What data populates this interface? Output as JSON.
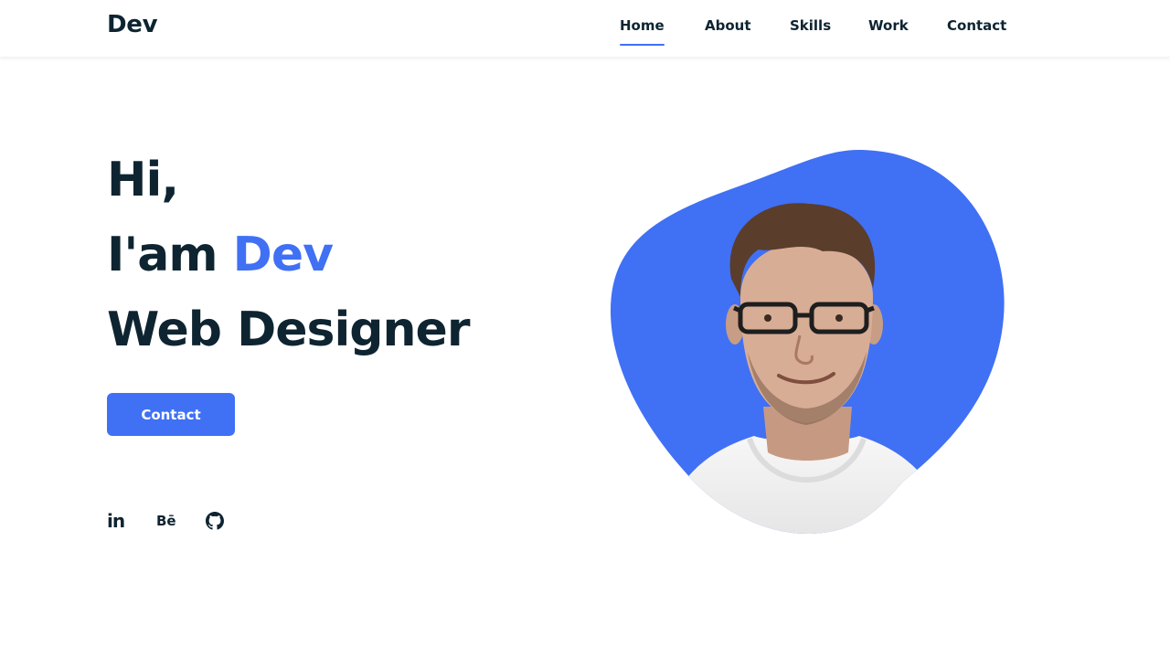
{
  "header": {
    "logo": "Dev",
    "nav": [
      {
        "label": "Home",
        "active": true
      },
      {
        "label": "About",
        "active": false
      },
      {
        "label": "Skills",
        "active": false
      },
      {
        "label": "Work",
        "active": false
      },
      {
        "label": "Contact",
        "active": false
      }
    ]
  },
  "hero": {
    "greeting": "Hi,",
    "intro_prefix": "I'am",
    "intro_name": "Dev",
    "role": "Web Designer",
    "button_label": "Contact"
  },
  "social": {
    "linkedin_glyph": "in",
    "behance_glyph": "Bē",
    "icons": [
      "linkedin-icon",
      "behance-icon",
      "github-icon"
    ]
  },
  "colors": {
    "accent": "#4070f4",
    "text": "#0e2431",
    "background": "#ffffff"
  }
}
